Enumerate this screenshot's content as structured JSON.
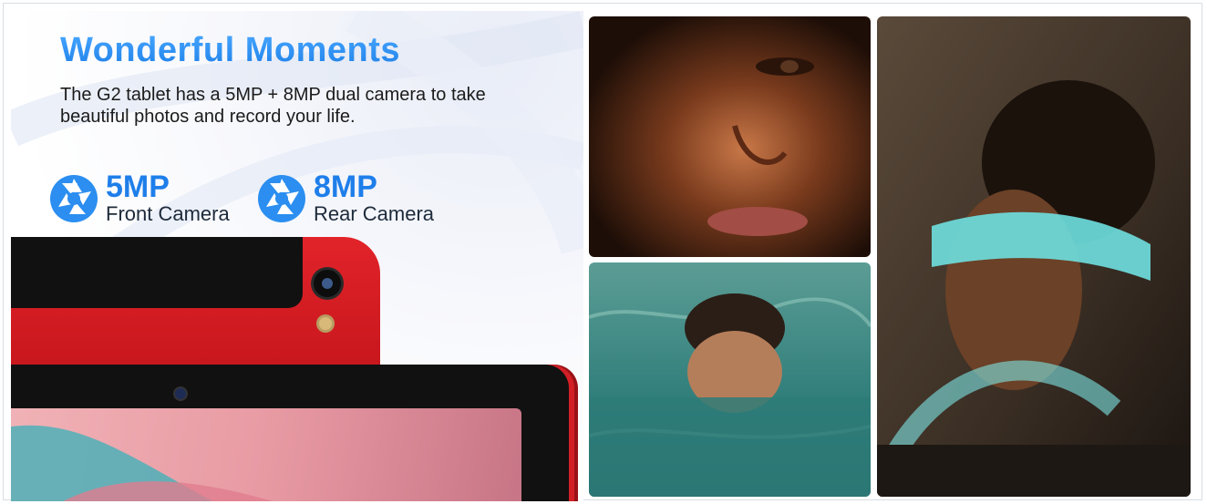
{
  "banner": {
    "title": "Wonderful Moments",
    "subtitle": "The G2 tablet has a 5MP + 8MP dual camera to take beautiful photos and record your life."
  },
  "cameras": [
    {
      "megapixels": "5MP",
      "label": "Front Camera",
      "icon": "camera-aperture-icon"
    },
    {
      "megapixels": "8MP",
      "label": "Rear Camera",
      "icon": "camera-aperture-icon"
    }
  ],
  "colors": {
    "accent": "#1f7fea",
    "tablet_body": "#d21f26",
    "text": "#1b1b1b"
  },
  "photos": [
    {
      "subject": "woman-face-closeup"
    },
    {
      "subject": "man-swimming-in-pool"
    },
    {
      "subject": "woman-with-blindfold"
    }
  ]
}
